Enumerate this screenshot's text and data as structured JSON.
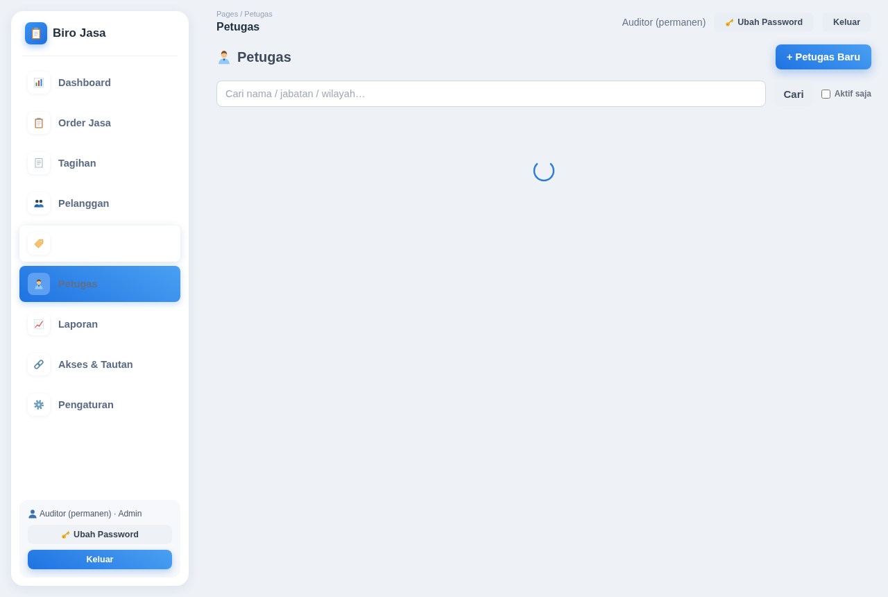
{
  "sidebar": {
    "brand": "Biro Jasa",
    "items": [
      {
        "label": "Dashboard",
        "selected": false,
        "hovered": false
      },
      {
        "label": "Order Jasa",
        "selected": false,
        "hovered": false
      },
      {
        "label": "Tagihan",
        "selected": false,
        "hovered": false
      },
      {
        "label": "Pelanggan",
        "selected": false,
        "hovered": false
      },
      {
        "selected": false,
        "hovered": true
      },
      {
        "label": "Petugas",
        "selected": true,
        "hovered": false
      },
      {
        "label": "Laporan",
        "selected": false,
        "hovered": false
      },
      {
        "label": "Akses & Tautan",
        "selected": false,
        "hovered": false
      },
      {
        "label": "Pengaturan",
        "selected": false,
        "hovered": false
      }
    ],
    "user": {
      "text": "Auditor (permanen) · Admin",
      "buttons": [
        {
          "label": "Ubah Password",
          "kind": "password"
        },
        {
          "label": "Keluar",
          "kind": "logout"
        }
      ]
    }
  },
  "topbar": {
    "breadcrumb": "Pages / Petugas",
    "title": "Petugas",
    "user": "Auditor (permanen)",
    "buttons": [
      {
        "label": "Ubah Password",
        "kind": "password"
      },
      {
        "label": "Keluar",
        "kind": "logout"
      }
    ]
  },
  "page": {
    "title": "Petugas",
    "new_button": "+ Petugas Baru",
    "search": {
      "placeholder": "Cari nama / jabatan / wilayah…"
    },
    "search_button": "Cari",
    "filter": {
      "label": "Aktif saja",
      "checked": false
    },
    "loading": true
  }
}
